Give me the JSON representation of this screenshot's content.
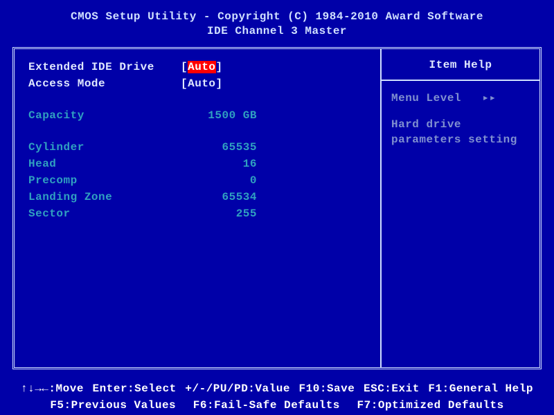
{
  "header": {
    "title": "CMOS Setup Utility - Copyright (C) 1984-2010 Award Software",
    "subtitle": "IDE Channel 3 Master"
  },
  "settings": {
    "extended_ide_label": "Extended IDE Drive",
    "extended_ide_value": "Auto",
    "access_mode_label": "Access Mode",
    "access_mode_value": "Auto"
  },
  "info": {
    "capacity_label": "Capacity",
    "capacity_value": "1500 GB",
    "cylinder_label": "Cylinder",
    "cylinder_value": "65535",
    "head_label": "Head",
    "head_value": "16",
    "precomp_label": "Precomp",
    "precomp_value": "0",
    "landing_zone_label": "Landing Zone",
    "landing_zone_value": "65534",
    "sector_label": "Sector",
    "sector_value": "255"
  },
  "help": {
    "title": "Item Help",
    "menu_level_label": "Menu Level",
    "menu_level_indicator": "▸▸",
    "description": "Hard drive parameters setting"
  },
  "footer": {
    "move": "↑↓→←:Move",
    "enter": "Enter:Select",
    "value": "+/-/PU/PD:Value",
    "save": "F10:Save",
    "exit": "ESC:Exit",
    "help": "F1:General Help",
    "prev": "F5:Previous Values",
    "failsafe": "F6:Fail-Safe Defaults",
    "optimized": "F7:Optimized Defaults"
  }
}
